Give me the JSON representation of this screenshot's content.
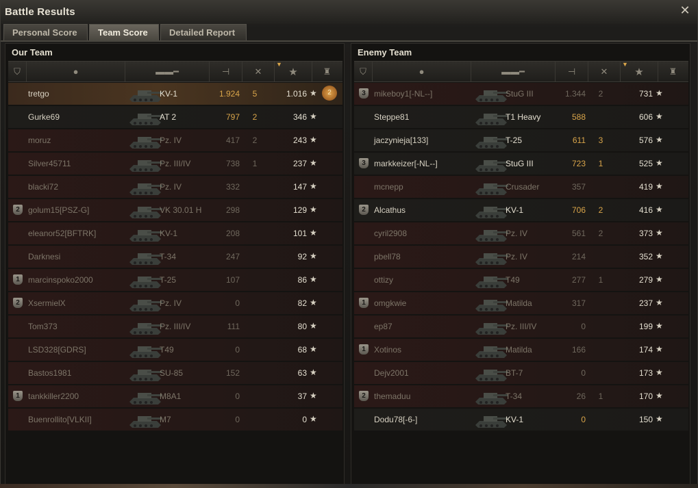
{
  "window": {
    "title": "Battle Results",
    "close_icon": "close-icon"
  },
  "tabs": [
    {
      "label": "Personal Score",
      "active": false
    },
    {
      "label": "Team Score",
      "active": true
    },
    {
      "label": "Detailed Report",
      "active": false
    }
  ],
  "header_icons": {
    "rank": "squad-shield-icon",
    "player": "player-silhouette-icon",
    "tank": "tank-silhouette-icon",
    "damage": "damage-shell-icon",
    "kills": "destroyed-tank-icon",
    "xp": "experience-star-icon",
    "medal": "medal-icon",
    "sort_indicator": "sort-arrow-icon"
  },
  "colors": {
    "gold": "#d9a54a",
    "self_row": "#4a3520",
    "dead_row": "#2b1917"
  },
  "our_team": {
    "title": "Our Team",
    "rows": [
      {
        "badge": "",
        "name": "tretgo",
        "tank": "KV-1",
        "damage": "1.924",
        "kills": "5",
        "xp": "1.016",
        "state": "self",
        "medal": "2"
      },
      {
        "badge": "",
        "name": "Gurke69",
        "tank": "AT 2",
        "damage": "797",
        "kills": "2",
        "xp": "346",
        "state": "alive"
      },
      {
        "badge": "",
        "name": "moruz",
        "tank": "Pz. IV",
        "damage": "417",
        "kills": "2",
        "xp": "243",
        "state": "dead"
      },
      {
        "badge": "",
        "name": "Silver45711",
        "tank": "Pz. III/IV",
        "damage": "738",
        "kills": "1",
        "xp": "237",
        "state": "dead"
      },
      {
        "badge": "",
        "name": "blacki72",
        "tank": "Pz. IV",
        "damage": "332",
        "kills": "",
        "xp": "147",
        "state": "dead"
      },
      {
        "badge": "2",
        "name": "golum15[PSZ-G]",
        "tank": "VK 30.01 H",
        "damage": "298",
        "kills": "",
        "xp": "129",
        "state": "dead"
      },
      {
        "badge": "",
        "name": "eleanor52[BFTRK]",
        "tank": "KV-1",
        "damage": "208",
        "kills": "",
        "xp": "101",
        "state": "dead"
      },
      {
        "badge": "",
        "name": "Darknesi",
        "tank": "T-34",
        "damage": "247",
        "kills": "",
        "xp": "92",
        "state": "dead"
      },
      {
        "badge": "1",
        "name": "marcinspoko2000",
        "tank": "T-25",
        "damage": "107",
        "kills": "",
        "xp": "86",
        "state": "dead"
      },
      {
        "badge": "2",
        "name": "XsermielX",
        "tank": "Pz. IV",
        "damage": "0",
        "kills": "",
        "xp": "82",
        "state": "dead"
      },
      {
        "badge": "",
        "name": "Tom373",
        "tank": "Pz. III/IV",
        "damage": "111",
        "kills": "",
        "xp": "80",
        "state": "dead"
      },
      {
        "badge": "",
        "name": "LSD328[GDRS]",
        "tank": "T49",
        "damage": "0",
        "kills": "",
        "xp": "68",
        "state": "dead"
      },
      {
        "badge": "",
        "name": "Bastos1981",
        "tank": "SU-85",
        "damage": "152",
        "kills": "",
        "xp": "63",
        "state": "dead"
      },
      {
        "badge": "1",
        "name": "tankkiller2200",
        "tank": "M8A1",
        "damage": "0",
        "kills": "",
        "xp": "37",
        "state": "dead"
      },
      {
        "badge": "",
        "name": "Buenrollito[VLKII]",
        "tank": "M7",
        "damage": "0",
        "kills": "",
        "xp": "0",
        "state": "dead"
      }
    ]
  },
  "enemy_team": {
    "title": "Enemy Team",
    "rows": [
      {
        "badge": "3",
        "name": "mikeboy1[-NL--]",
        "tank": "StuG III",
        "damage": "1.344",
        "kills": "2",
        "xp": "731",
        "state": "dead"
      },
      {
        "badge": "",
        "name": "Steppe81",
        "tank": "T1 Heavy",
        "damage": "588",
        "kills": "",
        "xp": "606",
        "state": "alive"
      },
      {
        "badge": "",
        "name": "jaczynieja[133]",
        "tank": "T-25",
        "damage": "611",
        "kills": "3",
        "xp": "576",
        "state": "alive"
      },
      {
        "badge": "3",
        "name": "markkeizer[-NL--]",
        "tank": "StuG III",
        "damage": "723",
        "kills": "1",
        "xp": "525",
        "state": "alive"
      },
      {
        "badge": "",
        "name": "mcnepp",
        "tank": "Crusader",
        "damage": "357",
        "kills": "",
        "xp": "419",
        "state": "dead"
      },
      {
        "badge": "2",
        "name": "Alcathus",
        "tank": "KV-1",
        "damage": "706",
        "kills": "2",
        "xp": "416",
        "state": "alive"
      },
      {
        "badge": "",
        "name": "cyril2908",
        "tank": "Pz. IV",
        "damage": "561",
        "kills": "2",
        "xp": "373",
        "state": "dead"
      },
      {
        "badge": "",
        "name": "pbell78",
        "tank": "Pz. IV",
        "damage": "214",
        "kills": "",
        "xp": "352",
        "state": "dead"
      },
      {
        "badge": "",
        "name": "ottizy",
        "tank": "T49",
        "damage": "277",
        "kills": "1",
        "xp": "279",
        "state": "dead"
      },
      {
        "badge": "1",
        "name": "omgkwie",
        "tank": "Matilda",
        "damage": "317",
        "kills": "",
        "xp": "237",
        "state": "dead"
      },
      {
        "badge": "",
        "name": "ep87",
        "tank": "Pz. III/IV",
        "damage": "0",
        "kills": "",
        "xp": "199",
        "state": "dead"
      },
      {
        "badge": "1",
        "name": "Xotinos",
        "tank": "Matilda",
        "damage": "166",
        "kills": "",
        "xp": "174",
        "state": "dead"
      },
      {
        "badge": "",
        "name": "Dejv2001",
        "tank": "BT-7",
        "damage": "0",
        "kills": "",
        "xp": "173",
        "state": "dead"
      },
      {
        "badge": "2",
        "name": "themaduu",
        "tank": "T-34",
        "damage": "26",
        "kills": "1",
        "xp": "170",
        "state": "dead"
      },
      {
        "badge": "",
        "name": "Dodu78[-6-]",
        "tank": "KV-1",
        "damage": "0",
        "kills": "",
        "xp": "150",
        "state": "alive"
      }
    ]
  }
}
